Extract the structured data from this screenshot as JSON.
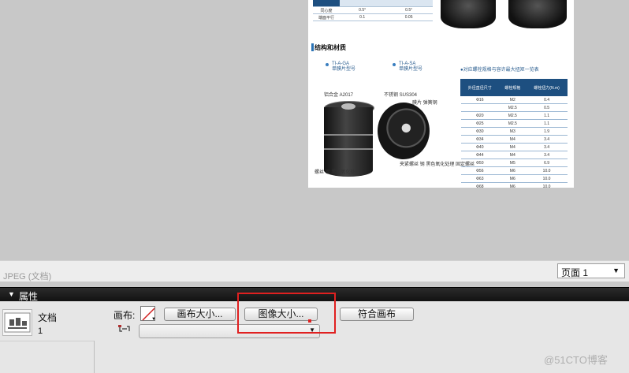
{
  "document": {
    "section_title": "结构和材质",
    "left_caption_line1": "TI-A-GA",
    "left_caption_line2": "单膜片型号",
    "right_caption_line1": "TI-A-SA",
    "right_caption_line2": "单膜片型号",
    "table_caption": "●对应螺栓规格与容许最大扭矩一览表",
    "table_headers": [
      "外径直径尺寸",
      "螺栓规格",
      "螺栓扭力(N.m)"
    ],
    "table_rows": [
      [
        "Φ16",
        "M2",
        "0.4"
      ],
      [
        "",
        "M2.5",
        "0.5"
      ],
      [
        "Φ20",
        "M2.5",
        "1.1"
      ],
      [
        "Φ25",
        "M2.5",
        "1.1"
      ],
      [
        "Φ30",
        "M3",
        "1.9"
      ],
      [
        "Φ34",
        "M4",
        "3.4"
      ],
      [
        "Φ40",
        "M4",
        "3.4"
      ],
      [
        "Φ44",
        "M4",
        "3.4"
      ],
      [
        "Φ50",
        "M5",
        "6.9"
      ],
      [
        "Φ56",
        "M6",
        "10.0"
      ],
      [
        "Φ63",
        "M6",
        "10.0"
      ],
      [
        "Φ68",
        "M6",
        "10.0"
      ]
    ],
    "top_table_rows": [
      [
        "",
        "",
        ""
      ],
      [
        "同心度",
        "0.5°",
        "0.5°"
      ],
      [
        "端面平行",
        "0.1",
        "0.05"
      ]
    ],
    "left_note_top": "铝合金 A2017",
    "left_note_bottom": "螺丝 钢 黑色氧化处理",
    "right_note_top": "不锈钢 SUS304",
    "right_note_mid": "膜片 弹簧钢",
    "right_note_bottom": "夹紧螺丝 钢 黑色氧化处理 固定螺丝"
  },
  "statusbar": {
    "file_info": "JPEG (文档)",
    "page_value": "页面 1"
  },
  "properties": {
    "panel_title": "属性",
    "doc_label": "文档",
    "doc_count": "1",
    "canvas_label": "画布:",
    "canvas_size_button": "画布大小...",
    "image_size_button": "图像大小...",
    "fit_canvas_button": "符合画布"
  },
  "icons": {
    "collapse": "triangle-down-icon",
    "page_dropdown": "chevron-down-icon",
    "document": "document-thumbnail-icon",
    "swatch": "no-color-swatch-icon",
    "link": "link-chain-icon"
  },
  "colors": {
    "highlight": "#e02020",
    "panel_header": "#1a1a1a",
    "table_header": "#1d4f80"
  },
  "watermark": "@51CTO博客"
}
